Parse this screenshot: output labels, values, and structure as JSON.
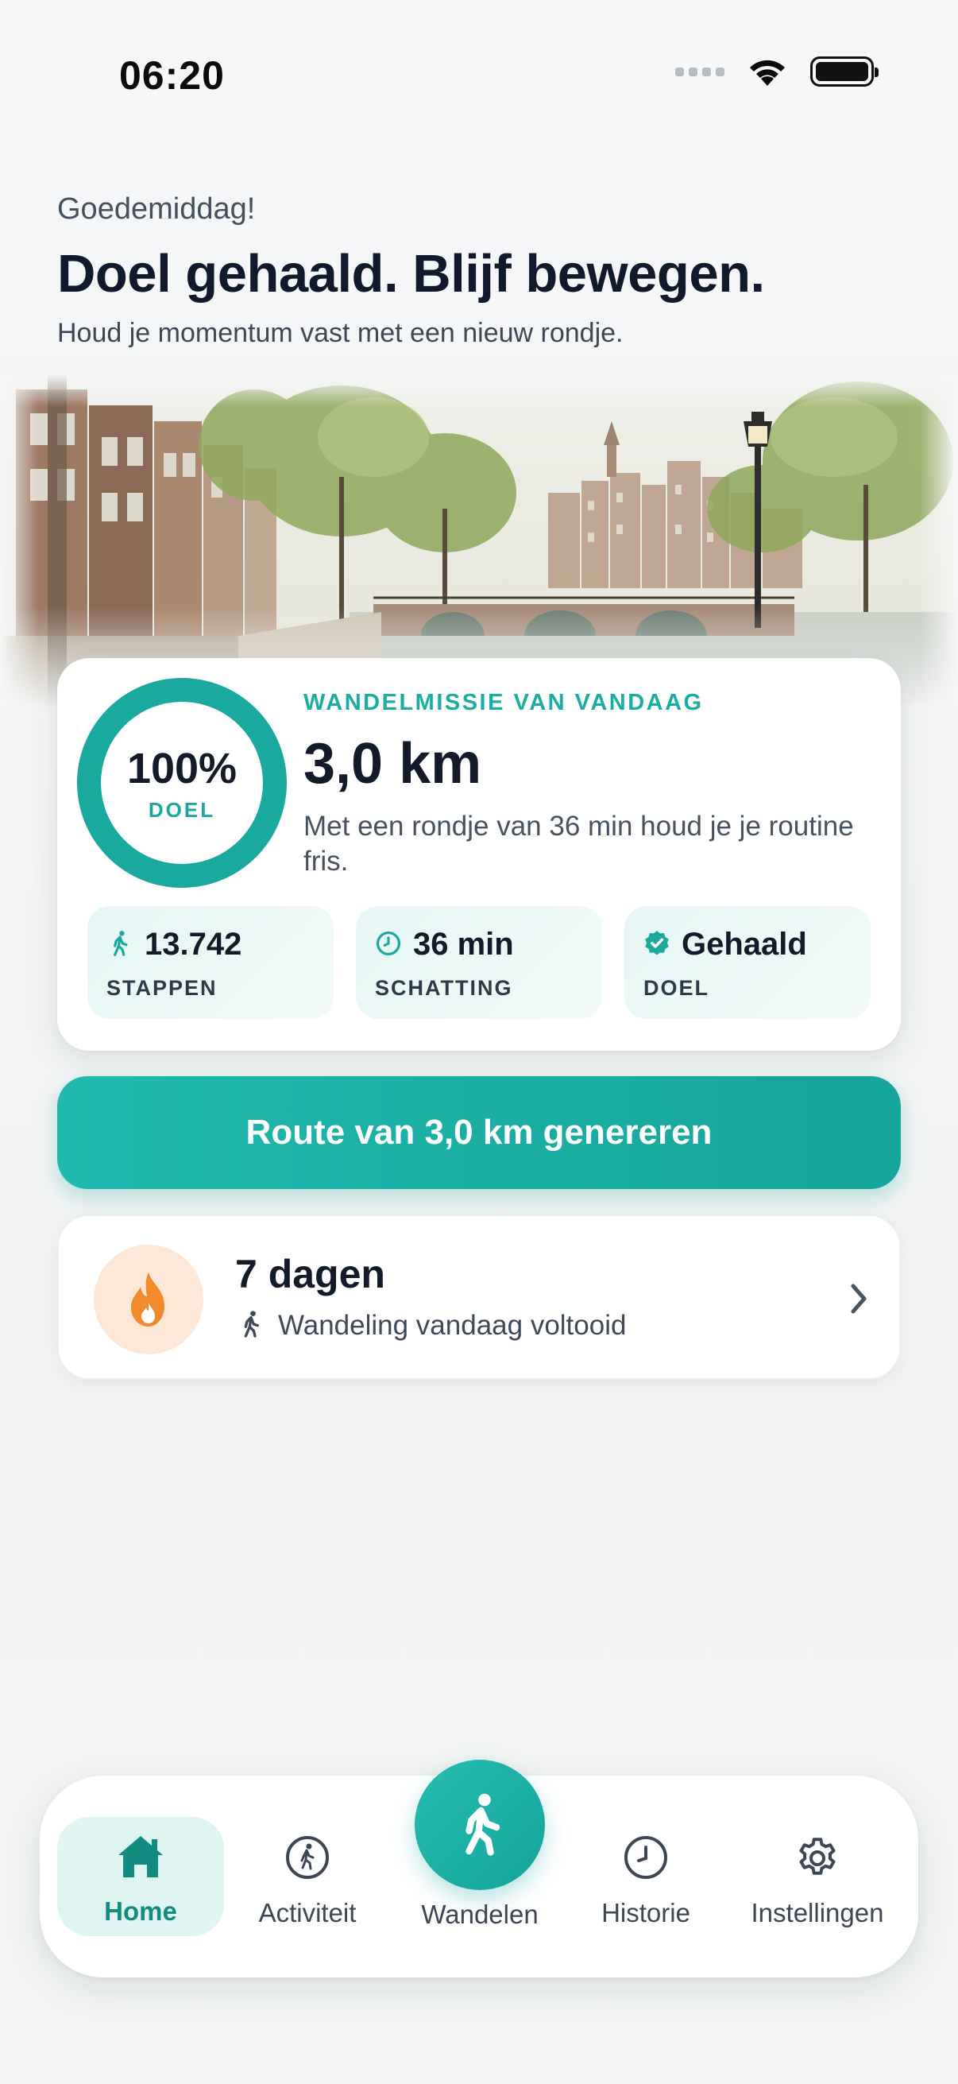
{
  "status_bar": {
    "time": "06:20"
  },
  "header": {
    "greeting": "Goedemiddag!",
    "headline": "Doel gehaald. Blijf bewegen.",
    "subline": "Houd je momentum vast met een nieuw rondje."
  },
  "mission": {
    "eyebrow": "WANDELMISSIE VAN VANDAAG",
    "distance": "3,0 km",
    "description": "Met een rondje van 36 min houd je je routine fris.",
    "progress_percent": 100,
    "progress_text": "100%",
    "progress_label": "DOEL",
    "stats": [
      {
        "icon": "walking-icon",
        "value": "13.742",
        "label": "STAPPEN"
      },
      {
        "icon": "clock-icon",
        "value": "36 min",
        "label": "SCHATTING"
      },
      {
        "icon": "verified-badge-icon",
        "value": "Gehaald",
        "label": "DOEL"
      }
    ]
  },
  "route_button": {
    "label": "Route van 3,0 km genereren"
  },
  "streak": {
    "title": "7 dagen",
    "subtitle": "Wandeling vandaag voltooid",
    "icon": "flame-icon"
  },
  "tabbar": {
    "active": "Home",
    "items": [
      {
        "label": "Home",
        "icon": "home-icon"
      },
      {
        "label": "Activiteit",
        "icon": "activity-icon"
      },
      {
        "label": "Wandelen",
        "icon": "walking-icon"
      },
      {
        "label": "Historie",
        "icon": "clock-icon"
      },
      {
        "label": "Instellingen",
        "icon": "gear-icon"
      }
    ]
  },
  "colors": {
    "accent": "#19AA9F",
    "accent_light": "#DFF5F2",
    "text_primary": "#131B2B",
    "text_secondary": "#465262",
    "flame_bg": "#FDE7D6",
    "flame": "#F08A2C"
  }
}
